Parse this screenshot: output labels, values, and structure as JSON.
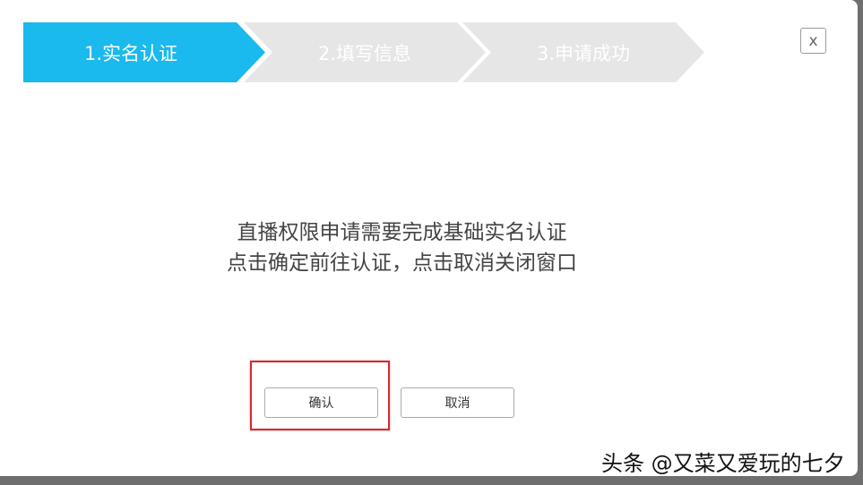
{
  "steps": [
    {
      "label": "1.实名认证",
      "state": "active",
      "color": "#1ab9ee"
    },
    {
      "label": "2.填写信息",
      "state": "inactive",
      "color": "#e6e6e6"
    },
    {
      "label": "3.申请成功",
      "state": "inactive",
      "color": "#e6e6e6"
    }
  ],
  "close_label": "x",
  "message": {
    "line1": "直播权限申请需要完成基础实名认证",
    "line2": "点击确定前往认证，点击取消关闭窗口"
  },
  "buttons": {
    "confirm_label": "确认",
    "cancel_label": "取消"
  },
  "watermark": "头条 @又菜又爱玩的七夕",
  "colors": {
    "accent": "#1ab9ee",
    "highlight": "#d9272e"
  }
}
